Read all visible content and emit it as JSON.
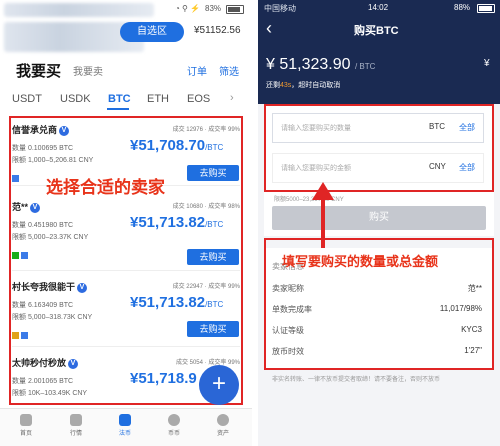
{
  "left": {
    "status": {
      "battery": "83%"
    },
    "market_tag": "自选区",
    "balance": "¥51152.56",
    "tabs": {
      "buy": "我要买",
      "sell": "我要卖",
      "orders": "订单",
      "filter": "筛选"
    },
    "coins": [
      "USDT",
      "USDK",
      "BTC",
      "ETH",
      "EOS"
    ],
    "more_icon": "chevron-right-icon",
    "annotation": "选择合适的卖家",
    "merchants": [
      {
        "name": "信誉承兑商",
        "stats": "成交 12976 · 成交率 99%",
        "qty_label": "数量",
        "qty": "0.100695 BTC",
        "limit_label": "限额",
        "limit": "1,000–5,206.81 CNY",
        "price": "¥51,708.70",
        "unit": "/BTC",
        "buy": "去购买"
      },
      {
        "name": "范**",
        "stats": "成交 10680 · 成交率 98%",
        "qty_label": "数量",
        "qty": "0.451980 BTC",
        "limit_label": "限额",
        "limit": "5,000–23.37K CNY",
        "price": "¥51,713.82",
        "unit": "/BTC",
        "buy": "去购买"
      },
      {
        "name": "村长夸我很能干",
        "stats": "成交 22947 · 成交率 99%",
        "qty_label": "数量",
        "qty": "6.163409 BTC",
        "limit_label": "限额",
        "limit": "5,000–318.73K CNY",
        "price": "¥51,713.82",
        "unit": "/BTC",
        "buy": "去购买"
      },
      {
        "name": "太帅秒付秒放",
        "stats": "成交 5054 · 成交率 99%",
        "qty_label": "数量",
        "qty": "2.001065 BTC",
        "limit_label": "限额",
        "limit": "10K–103.49K CNY",
        "price": "¥51,718.9",
        "unit": "",
        "buy": "去购买"
      }
    ],
    "fab": "+",
    "nav": [
      "首页",
      "行情",
      "法币",
      "币币",
      "资产"
    ]
  },
  "right": {
    "status": {
      "carrier": "中国移动",
      "time": "14:02",
      "battery": "88%"
    },
    "title": "购买BTC",
    "price": "¥ 51,323.90",
    "unit": "/ BTC",
    "countdown_pre": "还剩",
    "countdown_sec": "43s",
    "countdown_post": "，超时自动取消",
    "qty_placeholder": "请输入您要购买的数量",
    "qty_unit": "BTC",
    "all1": "全部",
    "amount_placeholder": "请输入您要购买的金额",
    "amount_unit": "CNY",
    "all2": "全部",
    "limit_text": "限额5000–23,397.40 CNY",
    "buy": "购买",
    "annotation": "填写要购买的数量或总金额",
    "seller_section": "卖家信息",
    "details": [
      {
        "k": "卖家昵称",
        "v": "范**"
      },
      {
        "k": "单数完成率",
        "v": "11,017/98%"
      },
      {
        "k": "认证等级",
        "v": "KYC3"
      },
      {
        "k": "放币时效",
        "v": "1'27\""
      }
    ],
    "footer": "非实名转账、一律不放币提交者取缔！请不要备注，否则不放币"
  },
  "colors": {
    "accent": "#1f6fe0",
    "header": "#1a2a52",
    "annotation": "#e02525"
  }
}
